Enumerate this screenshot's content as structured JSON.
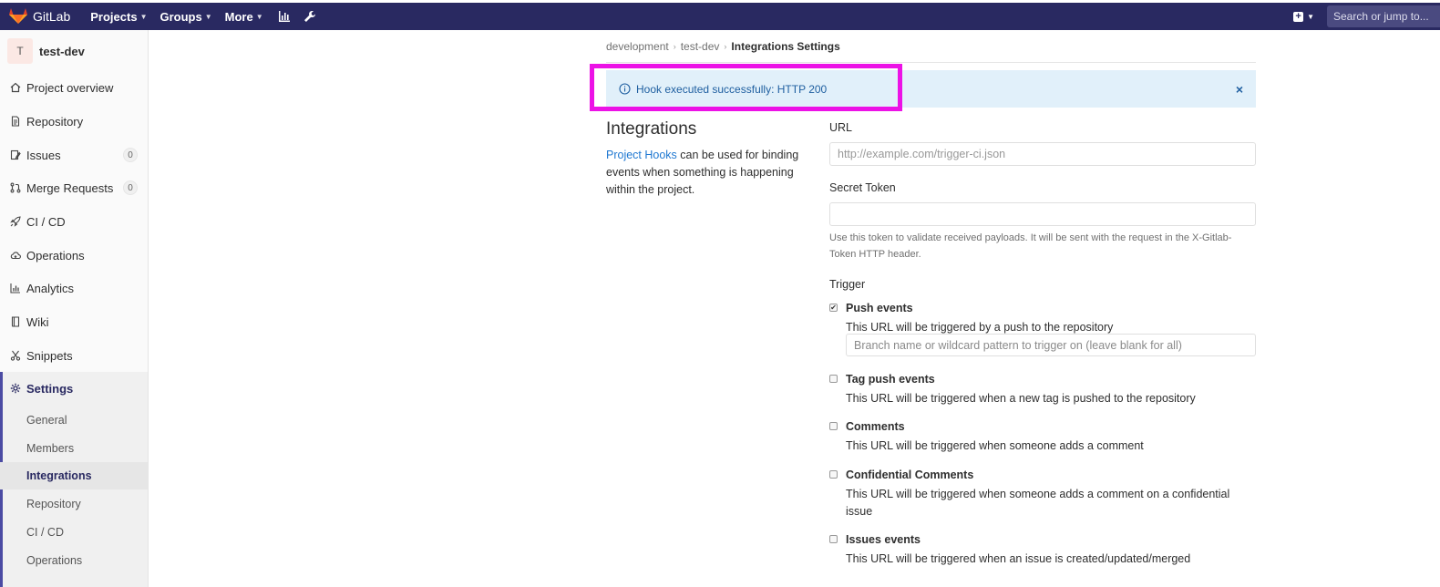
{
  "navbar": {
    "brand": "GitLab",
    "menus": [
      "Projects",
      "Groups",
      "More"
    ],
    "search_placeholder": "Search or jump to..."
  },
  "sidebar": {
    "project_initial": "T",
    "project_name": "test-dev",
    "items": [
      {
        "label": "Project overview",
        "icon": "home-icon"
      },
      {
        "label": "Repository",
        "icon": "doc-icon"
      },
      {
        "label": "Issues",
        "icon": "issues-icon",
        "badge": "0"
      },
      {
        "label": "Merge Requests",
        "icon": "merge-icon",
        "badge": "0"
      },
      {
        "label": "CI / CD",
        "icon": "rocket-icon"
      },
      {
        "label": "Operations",
        "icon": "cloud-icon"
      },
      {
        "label": "Analytics",
        "icon": "chart-icon"
      },
      {
        "label": "Wiki",
        "icon": "book-icon"
      },
      {
        "label": "Snippets",
        "icon": "scissors-icon"
      }
    ],
    "settings": {
      "label": "Settings",
      "sub": [
        "General",
        "Members",
        "Integrations",
        "Repository",
        "CI / CD",
        "Operations"
      ],
      "active": "Integrations"
    }
  },
  "breadcrumb": [
    "development",
    "test-dev",
    "Integrations Settings"
  ],
  "flash": {
    "message": "Hook executed successfully: HTTP 200",
    "close": "×"
  },
  "integrations": {
    "title": "Integrations",
    "desc_link": "Project Hooks",
    "desc_rest": " can be used for binding events when something is happening within the project."
  },
  "form": {
    "url_label": "URL",
    "url_placeholder": "http://example.com/trigger-ci.json",
    "token_label": "Secret Token",
    "token_help": "Use this token to validate received payloads. It will be sent with the request in the X-Gitlab-Token HTTP header.",
    "trigger_label": "Trigger",
    "branch_placeholder": "Branch name or wildcard pattern to trigger on (leave blank for all)",
    "triggers": [
      {
        "title": "Push events",
        "desc": "This URL will be triggered by a push to the repository",
        "checked": true
      },
      {
        "title": "Tag push events",
        "desc": "This URL will be triggered when a new tag is pushed to the repository",
        "checked": false
      },
      {
        "title": "Comments",
        "desc": "This URL will be triggered when someone adds a comment",
        "checked": false
      },
      {
        "title": "Confidential Comments",
        "desc": "This URL will be triggered when someone adds a comment on a confidential issue",
        "checked": false
      },
      {
        "title": "Issues events",
        "desc": "This URL will be triggered when an issue is created/updated/merged",
        "checked": false
      }
    ]
  },
  "colors": {
    "navbar": "#292961",
    "flash_bg": "#e1f0fa",
    "link": "#1f78d1",
    "highlight": "#ec12e6"
  }
}
